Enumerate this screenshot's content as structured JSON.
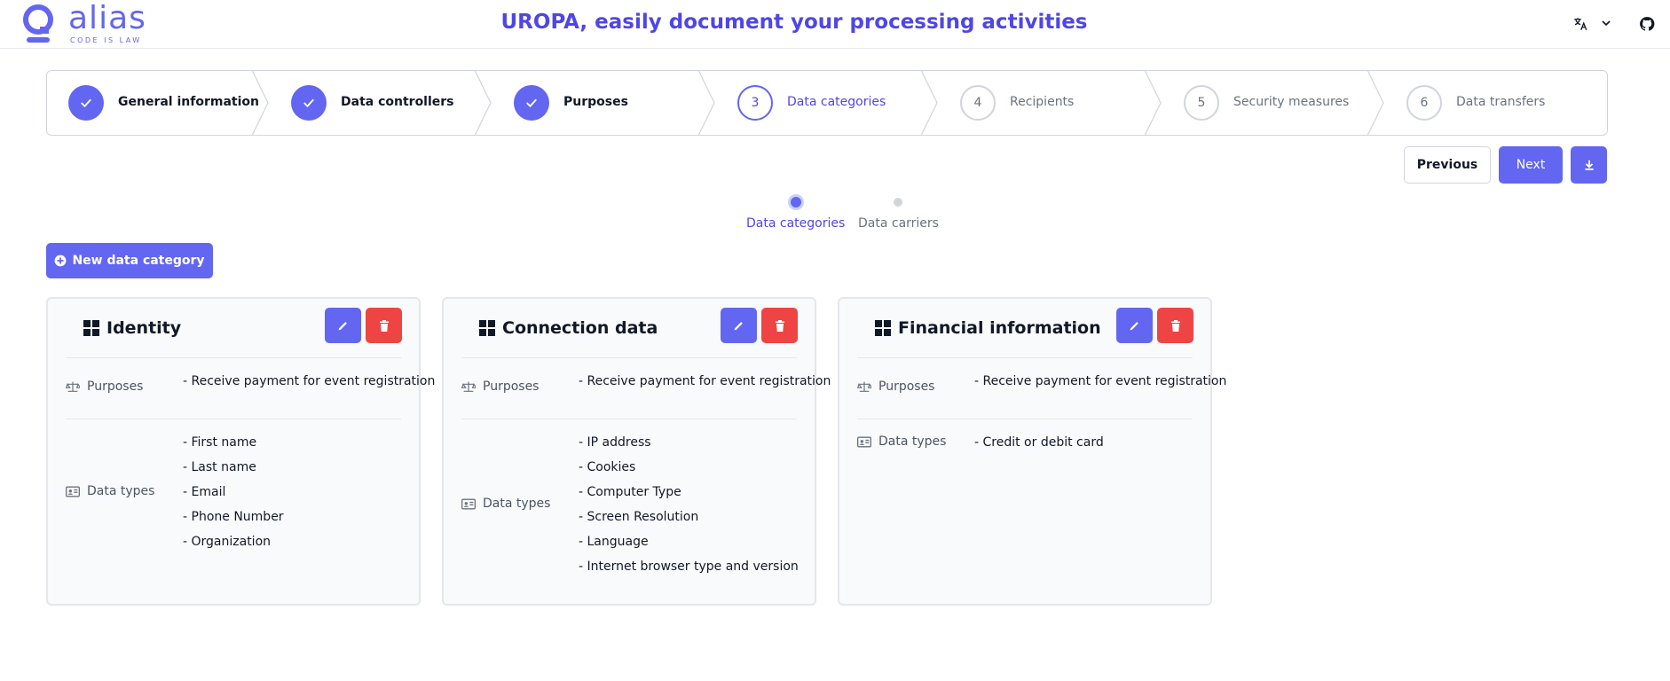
{
  "header": {
    "logo_word": "alias",
    "logo_tagline": "CODE IS LAW",
    "title": "UROPA, easily document your processing activities",
    "icons": [
      "translate-icon",
      "chevron-down-icon",
      "github-icon"
    ]
  },
  "stepper": {
    "steps": [
      {
        "number": "1",
        "label": "General information",
        "state": "done"
      },
      {
        "number": "2",
        "label": "Data controllers",
        "state": "done"
      },
      {
        "number": "3",
        "label": "Purposes",
        "state": "done"
      },
      {
        "number": "3",
        "label": "Data categories",
        "state": "current"
      },
      {
        "number": "4",
        "label": "Recipients",
        "state": "todo"
      },
      {
        "number": "5",
        "label": "Security measures",
        "state": "todo"
      },
      {
        "number": "6",
        "label": "Data transfers",
        "state": "todo"
      }
    ]
  },
  "actions": {
    "previous_label": "Previous",
    "next_label": "Next",
    "download_icon": "download-icon"
  },
  "substeps": [
    {
      "label": "Data categories",
      "active": true
    },
    {
      "label": "Data carriers",
      "active": false
    }
  ],
  "new_button_label": "New data category",
  "labels": {
    "purposes": "Purposes",
    "data_types": "Data types"
  },
  "cards": [
    {
      "title": "Identity",
      "purposes": [
        "- Receive payment for event registration"
      ],
      "data_types": [
        "- First name",
        "- Last name",
        "- Email",
        "- Phone Number",
        "- Organization"
      ]
    },
    {
      "title": "Connection data",
      "purposes": [
        "- Receive payment for event registration"
      ],
      "data_types": [
        "- IP address",
        "- Cookies",
        "- Computer Type",
        "- Screen Resolution",
        "- Language",
        "- Internet browser type and version"
      ]
    },
    {
      "title": "Financial information",
      "purposes": [
        "- Receive payment for event registration"
      ],
      "data_types": [
        "- Credit or debit card"
      ]
    }
  ],
  "colors": {
    "primary": "#6366f1",
    "title": "#4f46e5",
    "danger": "#ef4444"
  }
}
